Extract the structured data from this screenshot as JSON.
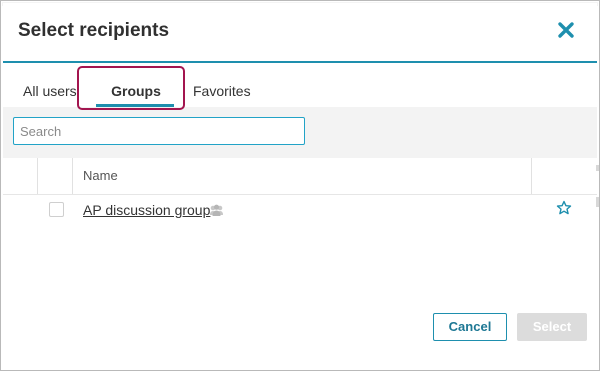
{
  "dialog": {
    "title": "Select recipients",
    "close_icon": "close-icon",
    "accent_color": "#1e8fae"
  },
  "tabs": [
    {
      "label": "All users",
      "active": false
    },
    {
      "label": "Groups",
      "active": true
    },
    {
      "label": "Favorites",
      "active": false
    }
  ],
  "search": {
    "placeholder": "Search",
    "value": ""
  },
  "table": {
    "columns": [
      "",
      "",
      "Name",
      ""
    ],
    "rows": [
      {
        "name": "AP discussion group",
        "icon": "group-icon",
        "checked": false,
        "favorite_icon": "star-outline-icon"
      }
    ]
  },
  "footer": {
    "cancel_label": "Cancel",
    "select_label": "Select",
    "select_enabled": false
  }
}
